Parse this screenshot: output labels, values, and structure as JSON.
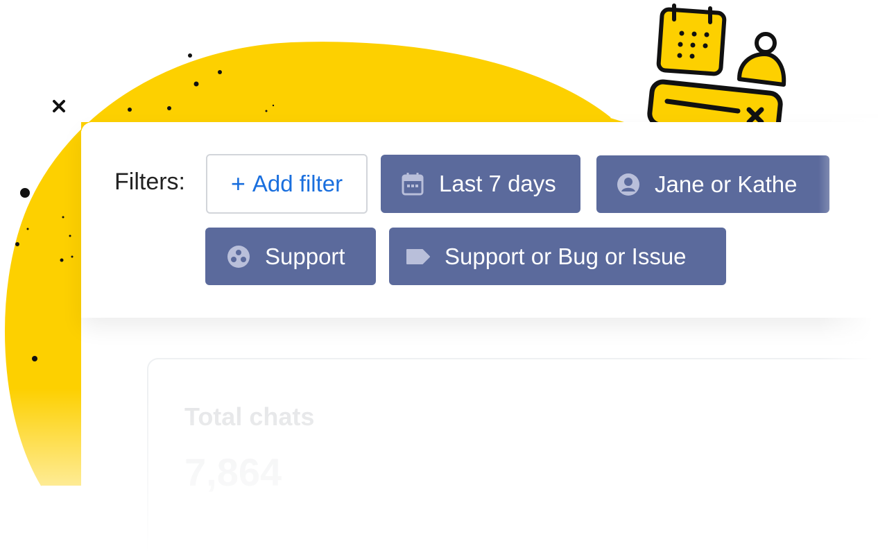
{
  "filters": {
    "label": "Filters:",
    "add_filter": {
      "plus": "+",
      "label": "Add filter"
    },
    "chips": [
      {
        "label": "Last 7 days",
        "icon": "calendar-icon"
      },
      {
        "label": "Jane or Kathe",
        "icon": "user-circle-icon"
      },
      {
        "label": "Support",
        "icon": "group-icon"
      },
      {
        "label": "Support or Bug or Issue",
        "icon": "tag-icon"
      }
    ]
  },
  "stats": {
    "label": "Total chats",
    "value": "7,864"
  },
  "colors": {
    "accent_yellow": "#fdd000",
    "chip_background": "#5b6a9c",
    "link_blue": "#1a6fde",
    "icon_muted": "#b9bfda"
  },
  "decorations": {
    "illustration": "calendar-agent-doodle-icon"
  }
}
